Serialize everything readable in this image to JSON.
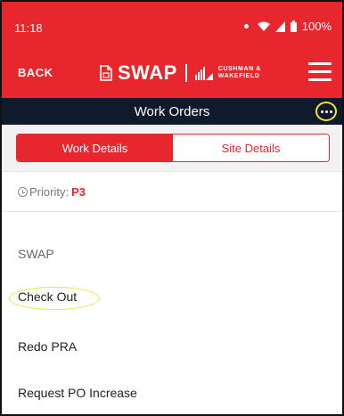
{
  "status_bar": {
    "time": "11:18",
    "battery": "100%",
    "icons": [
      "notification-dot-icon",
      "wifi-icon",
      "signal-icon",
      "battery-icon"
    ]
  },
  "app_bar": {
    "back_label": "BACK",
    "logo_text": "SWAP",
    "partner_line1": "CUSHMAN &",
    "partner_line2": "WAKEFIELD",
    "menu_icon": "hamburger-menu-icon"
  },
  "title_bar": {
    "title": "Work Orders",
    "more_icon": "more-options-icon"
  },
  "tabs": [
    {
      "label": "Work Details",
      "active": true
    },
    {
      "label": "Site Details",
      "active": false
    }
  ],
  "priority": {
    "label": "Priority:",
    "value": "P3"
  },
  "list": {
    "section_header": "SWAP",
    "items": [
      {
        "label": "Check Out"
      },
      {
        "label": "Redo PRA"
      },
      {
        "label": "Request PO Increase"
      }
    ]
  },
  "colors": {
    "brand_red": "#e8262e",
    "title_bar_bg": "#0f1a2b",
    "highlight_ring": "#f2e339"
  }
}
